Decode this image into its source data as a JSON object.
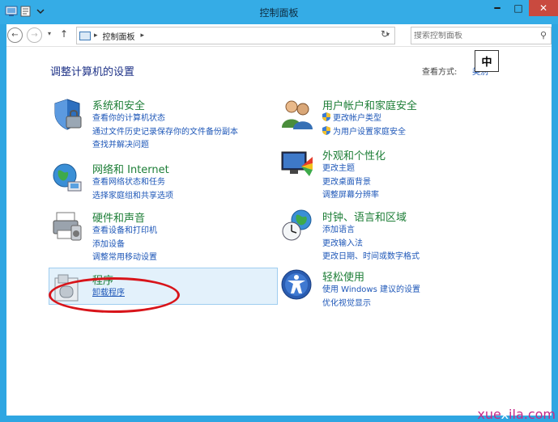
{
  "window": {
    "title": "控制面板",
    "minimize": "━",
    "maximize": "□",
    "close": "✕"
  },
  "nav": {
    "back": "←",
    "forward": "→",
    "recent": "▾",
    "up": "↑",
    "breadcrumb_sep": "▸",
    "breadcrumb": "控制面板",
    "refresh": "↻",
    "search_placeholder": "搜索控制面板"
  },
  "main": {
    "title": "调整计算机的设置",
    "view_by_label": "查看方式:",
    "view_by_value": "类别",
    "ime_indicator": "中"
  },
  "categories": [
    {
      "icon": "security-shield-icon",
      "title": "系统和安全",
      "links": [
        "查看你的计算机状态",
        "通过文件历史记录保存你的文件备份副本",
        "查找并解决问题"
      ]
    },
    {
      "icon": "network-globe-icon",
      "title": "网络和 Internet",
      "links": [
        "查看网络状态和任务",
        "选择家庭组和共享选项"
      ]
    },
    {
      "icon": "printer-icon",
      "title": "硬件和声音",
      "links": [
        "查看设备和打印机",
        "添加设备",
        "调整常用移动设置"
      ]
    },
    {
      "icon": "programs-box-icon",
      "title": "程序",
      "links": [
        "卸载程序"
      ]
    },
    {
      "icon": "users-icon",
      "title": "用户帐户和家庭安全",
      "links": [
        "更改帐户类型",
        "为用户设置家庭安全"
      ]
    },
    {
      "icon": "display-paint-icon",
      "title": "外观和个性化",
      "links": [
        "更改主题",
        "更改桌面背景",
        "调整屏幕分辨率"
      ]
    },
    {
      "icon": "clock-globe-icon",
      "title": "时钟、语言和区域",
      "links": [
        "添加语言",
        "更改输入法",
        "更改日期、时间或数字格式"
      ]
    },
    {
      "icon": "ease-of-access-icon",
      "title": "轻松使用",
      "links": [
        "使用 Windows 建议的设置",
        "优化视觉显示"
      ]
    }
  ],
  "watermark": {
    "prefix": "xue",
    "mid": "x",
    "suffix": "ila.com"
  },
  "colors": {
    "title_bar": "#35ace6",
    "category_title": "#1d7e37",
    "link": "#1e57b8",
    "highlight": "#d8141a"
  }
}
